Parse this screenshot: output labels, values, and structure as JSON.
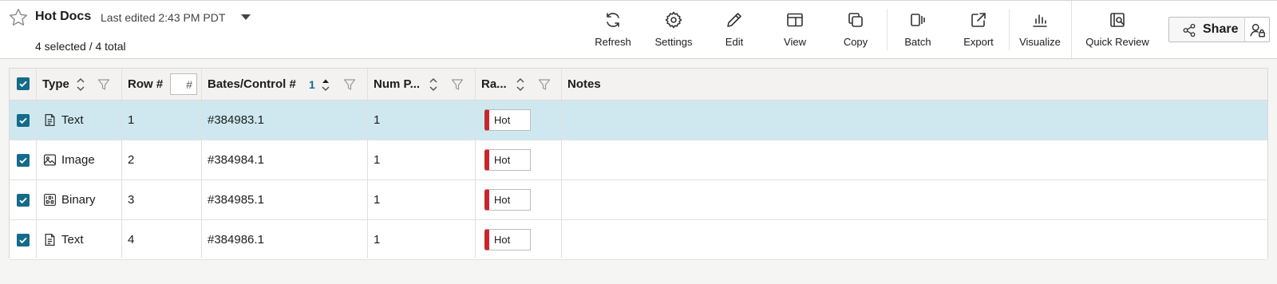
{
  "header": {
    "title": "Hot Docs",
    "last_edited": "Last edited 2:43 PM PDT",
    "selection": "4 selected / 4 total"
  },
  "toolbar": {
    "refresh": "Refresh",
    "settings": "Settings",
    "edit": "Edit",
    "view": "View",
    "copy": "Copy",
    "batch": "Batch",
    "export": "Export",
    "visualize": "Visualize",
    "quick_review": "Quick Review",
    "share": "Share"
  },
  "table": {
    "columns": {
      "type": "Type",
      "row": "Row #",
      "row_filter_placeholder": "#",
      "bates": "Bates/Control #",
      "bates_sort_index": "1",
      "num_pages": "Num P...",
      "rating": "Ra...",
      "notes": "Notes"
    },
    "rows": [
      {
        "type": "Text",
        "type_icon": "text-document-icon",
        "row": "1",
        "bates": "#384983.1",
        "pages": "1",
        "rating": "Hot",
        "notes": ""
      },
      {
        "type": "Image",
        "type_icon": "image-icon",
        "row": "2",
        "bates": "#384984.1",
        "pages": "1",
        "rating": "Hot",
        "notes": ""
      },
      {
        "type": "Binary",
        "type_icon": "binary-icon",
        "row": "3",
        "bates": "#384985.1",
        "pages": "1",
        "rating": "Hot",
        "notes": ""
      },
      {
        "type": "Text",
        "type_icon": "text-document-icon",
        "row": "4",
        "bates": "#384986.1",
        "pages": "1",
        "rating": "Hot",
        "notes": ""
      }
    ]
  },
  "colors": {
    "accent": "#146b8a",
    "selected_row": "#cfe8ef",
    "hot_tag": "#c8262f"
  }
}
